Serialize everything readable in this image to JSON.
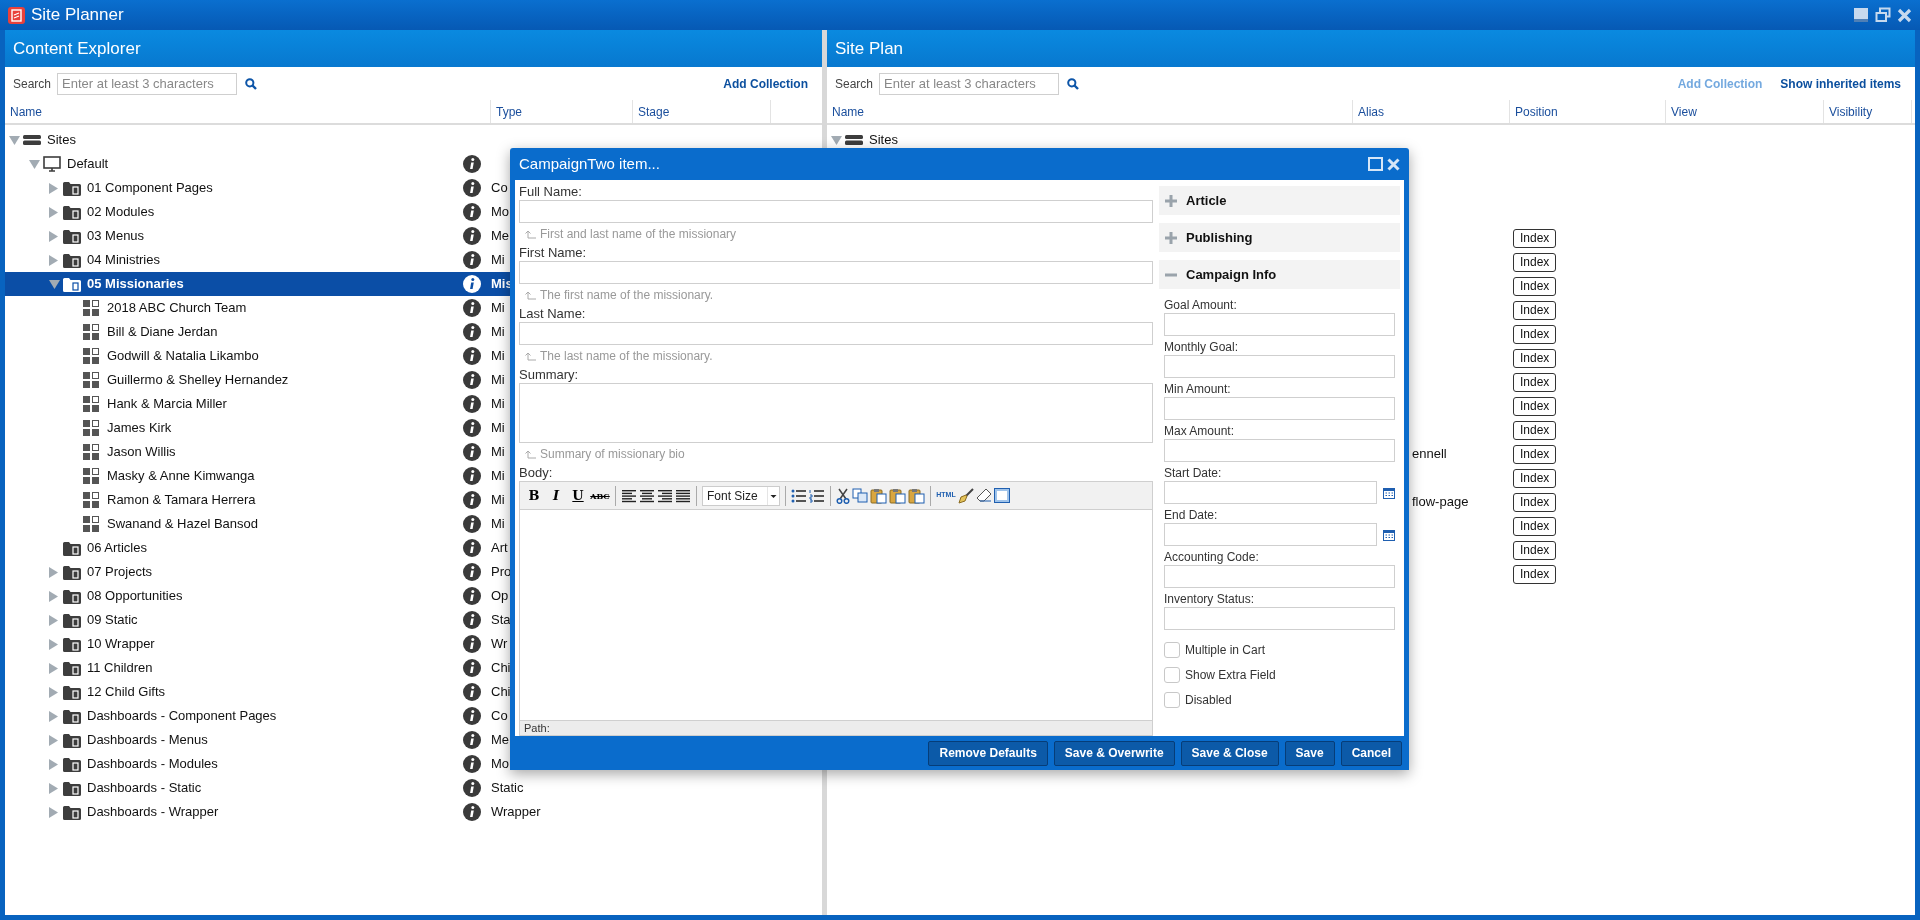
{
  "window": {
    "title": "Site Planner"
  },
  "content_explorer": {
    "title": "Content Explorer",
    "search": {
      "label": "Search",
      "placeholder": "Enter at least 3 characters"
    },
    "links": [
      {
        "text": "Add Collection",
        "disabled": false
      }
    ],
    "columns": [
      "Name",
      "Type",
      "Stage"
    ],
    "tree": [
      {
        "kind": "site",
        "name": "Sites",
        "info": false,
        "expanded": true,
        "selected": false,
        "children": [
          {
            "kind": "monitor",
            "name": "Default",
            "info": true,
            "expanded": true,
            "selected": false,
            "children": [
              {
                "kind": "folder",
                "name": "01 Component Pages",
                "type": "Co",
                "info": true,
                "expanded": false,
                "selected": false
              },
              {
                "kind": "folder",
                "name": "02 Modules",
                "type": "Mo",
                "info": true,
                "expanded": false,
                "selected": false
              },
              {
                "kind": "folder",
                "name": "03 Menus",
                "type": "Me",
                "info": true,
                "expanded": false,
                "selected": false
              },
              {
                "kind": "folder",
                "name": "04 Ministries",
                "type": "Mi",
                "info": true,
                "expanded": false,
                "selected": false
              },
              {
                "kind": "folder",
                "name": "05 Missionaries",
                "type": "Mis",
                "info": true,
                "expanded": true,
                "selected": true,
                "children": [
                  {
                    "kind": "page",
                    "name": "2018 ABC Church Team",
                    "type": "Mi",
                    "info": true,
                    "selected": false
                  },
                  {
                    "kind": "page",
                    "name": "Bill & Diane Jerdan",
                    "type": "Mi",
                    "info": true,
                    "selected": false
                  },
                  {
                    "kind": "page",
                    "name": "Godwill & Natalia Likambo",
                    "type": "Mi",
                    "info": true,
                    "selected": false
                  },
                  {
                    "kind": "page",
                    "name": "Guillermo & Shelley Hernandez",
                    "type": "Mi",
                    "info": true,
                    "selected": false
                  },
                  {
                    "kind": "page",
                    "name": "Hank & Marcia Miller",
                    "type": "Mi",
                    "info": true,
                    "selected": false
                  },
                  {
                    "kind": "page",
                    "name": "James Kirk",
                    "type": "Mi",
                    "info": true,
                    "selected": false
                  },
                  {
                    "kind": "page",
                    "name": "Jason Willis",
                    "type": "Mi",
                    "info": true,
                    "selected": false
                  },
                  {
                    "kind": "page",
                    "name": "Masky & Anne Kimwanga",
                    "type": "Mi",
                    "info": true,
                    "selected": false
                  },
                  {
                    "kind": "page",
                    "name": "Ramon & Tamara Herrera",
                    "type": "Mi",
                    "info": true,
                    "selected": false
                  },
                  {
                    "kind": "page",
                    "name": "Swanand & Hazel Bansod",
                    "type": "Mi",
                    "info": true,
                    "selected": false
                  }
                ]
              },
              {
                "kind": "folder",
                "name": "06 Articles",
                "type": "Art",
                "info": true,
                "selected": false
              },
              {
                "kind": "folder",
                "name": "07 Projects",
                "type": "Pro",
                "info": true,
                "expanded": false,
                "selected": false
              },
              {
                "kind": "folder",
                "name": "08 Opportunities",
                "type": "Op",
                "info": true,
                "expanded": false,
                "selected": false
              },
              {
                "kind": "folder",
                "name": "09 Static",
                "type": "Sta",
                "info": true,
                "expanded": false,
                "selected": false
              },
              {
                "kind": "folder",
                "name": "10 Wrapper",
                "type": "Wr",
                "info": true,
                "expanded": false,
                "selected": false
              },
              {
                "kind": "folder",
                "name": "11 Children",
                "type": "Chi",
                "info": true,
                "expanded": false,
                "selected": false
              },
              {
                "kind": "folder",
                "name": "12 Child Gifts",
                "type": "Chi",
                "info": true,
                "expanded": false,
                "selected": false
              },
              {
                "kind": "folder",
                "name": "Dashboards - Component Pages",
                "type": "Co",
                "info": true,
                "expanded": false,
                "selected": false
              },
              {
                "kind": "folder",
                "name": "Dashboards - Menus",
                "type": "Me",
                "info": true,
                "expanded": false,
                "selected": false
              },
              {
                "kind": "folder",
                "name": "Dashboards - Modules",
                "type": "Mo",
                "info": true,
                "expanded": false,
                "selected": false
              },
              {
                "kind": "folder",
                "name": "Dashboards - Static",
                "type": "Static",
                "info": true,
                "expanded": false,
                "selected": false
              },
              {
                "kind": "folder",
                "name": "Dashboards - Wrapper",
                "type": "Wrapper",
                "info": true,
                "expanded": false,
                "selected": false
              }
            ]
          }
        ]
      }
    ]
  },
  "site_plan": {
    "title": "Site Plan",
    "search": {
      "label": "Search",
      "placeholder": "Enter at least 3 characters"
    },
    "links": [
      {
        "text": "Add Collection",
        "disabled": true
      },
      {
        "text": "Show inherited items",
        "disabled": false
      }
    ],
    "columns": [
      "Name",
      "Alias",
      "Position",
      "View",
      "Visibility"
    ],
    "tree": [
      {
        "kind": "site",
        "name": "Sites",
        "expanded": true
      }
    ],
    "rows": [
      {
        "position": "Index"
      },
      {
        "position": "Index"
      },
      {
        "position": "Index"
      },
      {
        "position": "Index"
      },
      {
        "position": "Index"
      },
      {
        "position": "Index"
      },
      {
        "position": "Index"
      },
      {
        "position": "Index"
      },
      {
        "position": "Index"
      },
      {
        "alias": "ennell",
        "position": "Index"
      },
      {
        "position": "Index"
      },
      {
        "alias": "flow-page",
        "position": "Index"
      },
      {
        "position": "Index"
      },
      {
        "position": "Index"
      },
      {
        "position": "Index"
      }
    ]
  },
  "dialog": {
    "title": "CampaignTwo item...",
    "fields": [
      {
        "kind": "text",
        "label": "Full Name:",
        "hint": "First and last name of the missionary"
      },
      {
        "kind": "text",
        "label": "First Name:",
        "hint": "The first name of the missionary."
      },
      {
        "kind": "text",
        "label": "Last Name:",
        "hint": "The last name of the missionary."
      },
      {
        "kind": "textarea",
        "label": "Summary:",
        "hint": "Summary of missionary bio"
      },
      {
        "kind": "editor",
        "label": "Body:"
      }
    ],
    "editor": {
      "status": "Path:",
      "toolbar": [
        {
          "kind": "bold",
          "text": "B"
        },
        {
          "kind": "italic",
          "text": "I"
        },
        {
          "kind": "underline",
          "text": "U"
        },
        {
          "kind": "strike",
          "text": "ABC"
        },
        {
          "kind": "sep"
        },
        {
          "kind": "align-left"
        },
        {
          "kind": "align-center"
        },
        {
          "kind": "align-right"
        },
        {
          "kind": "justify"
        },
        {
          "kind": "sep"
        },
        {
          "kind": "select",
          "text": "Font Size"
        },
        {
          "kind": "sep"
        },
        {
          "kind": "bullets"
        },
        {
          "kind": "numbers"
        },
        {
          "kind": "sep"
        },
        {
          "kind": "cut"
        },
        {
          "kind": "copy"
        },
        {
          "kind": "paste"
        },
        {
          "kind": "paste"
        },
        {
          "kind": "paste"
        },
        {
          "kind": "sep"
        },
        {
          "kind": "html",
          "text": "HTML"
        },
        {
          "kind": "brush"
        },
        {
          "kind": "eraser"
        },
        {
          "kind": "window"
        }
      ]
    },
    "sections": [
      {
        "title": "Article",
        "expanded": false
      },
      {
        "title": "Publishing",
        "expanded": false
      },
      {
        "title": "Campaign Info",
        "expanded": true,
        "fields": [
          {
            "kind": "text",
            "label": "Goal Amount:"
          },
          {
            "kind": "text",
            "label": "Monthly Goal:"
          },
          {
            "kind": "text",
            "label": "Min Amount:"
          },
          {
            "kind": "text",
            "label": "Max Amount:"
          },
          {
            "kind": "date",
            "label": "Start Date:"
          },
          {
            "kind": "date",
            "label": "End Date:"
          },
          {
            "kind": "text",
            "label": "Accounting Code:"
          },
          {
            "kind": "text",
            "label": "Inventory Status:"
          },
          {
            "kind": "checkbox",
            "label": "Multiple in Cart",
            "checked": false
          },
          {
            "kind": "checkbox",
            "label": "Show Extra Field",
            "checked": false
          },
          {
            "kind": "checkbox",
            "label": "Disabled",
            "checked": false
          }
        ]
      }
    ],
    "buttons": [
      "Remove Defaults",
      "Save & Overwrite",
      "Save & Close",
      "Save",
      "Cancel"
    ]
  }
}
